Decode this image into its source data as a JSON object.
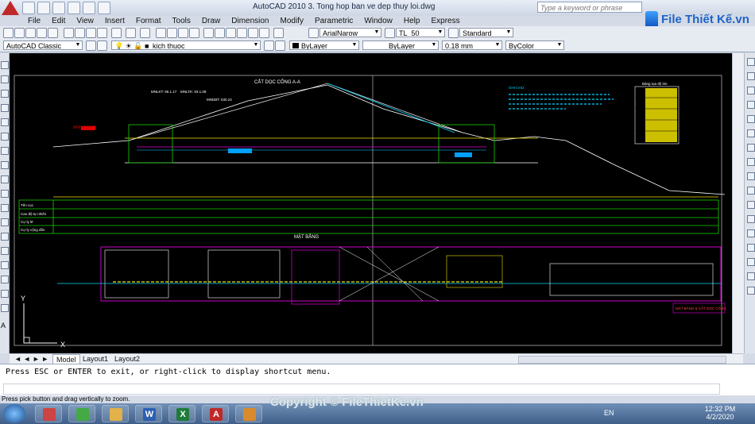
{
  "window": {
    "title": "AutoCAD 2010     3. Tong hop ban ve dep thuy loi.dwg",
    "search_placeholder": "Type a keyword or phrase"
  },
  "brand": {
    "name": "File Thiết Kế.vn"
  },
  "menu": [
    "File",
    "Edit",
    "View",
    "Insert",
    "Format",
    "Tools",
    "Draw",
    "Dimension",
    "Modify",
    "Parametric",
    "Window",
    "Help",
    "Express"
  ],
  "toolbar1": {
    "text_style": "ArialNarow",
    "dim_style": "TL_50",
    "table_style": "Standard"
  },
  "toolbar2": {
    "workspace": "AutoCAD Classic",
    "layer": "kich thuoc",
    "color": "ByLayer",
    "linetype": "ByLayer",
    "lineweight": "0.18 mm",
    "plotstyle": "ByColor"
  },
  "drawing": {
    "section_title": "CẮT DỌC CỐNG A-A",
    "plan_title": "MẶT BẰNG",
    "levels": [
      "MNLKT: 95.1.17",
      "MNLTK: 93.1.08",
      "MNDBT: 530.24"
    ],
    "water_level_label": "MNC 8.48.75",
    "row_labels": [
      "Tên cọc",
      "Cao độ tự nhiên",
      "Cự ly lẻ",
      "Cự ly cộng dồn"
    ],
    "notes_title": "GHI CHÚ:",
    "table_title": "Bảng tọa độ tim",
    "frame_title": "MẶT BẰNG & CẮT DỌC CỐNG",
    "axis_labels": {
      "y": "Y",
      "x": "X"
    }
  },
  "layout_tabs": [
    "Model",
    "Layout1",
    "Layout2"
  ],
  "command": {
    "history": "Press ESC or ENTER to exit, or right-click to display shortcut menu.",
    "prompt": ""
  },
  "status_bar": {
    "text": "Press pick button and drag vertically to zoom."
  },
  "watermark": "Copyright © FileThietKe.vn",
  "taskbar": {
    "language": "EN",
    "time": "12:32 PM",
    "date": "4/2/2020"
  },
  "colors": {
    "canvas": "#000000",
    "green_line": "#18d000",
    "yellow": "#f0e000",
    "magenta": "#e000e0",
    "cyan": "#00d8ff",
    "white": "#ffffff"
  }
}
